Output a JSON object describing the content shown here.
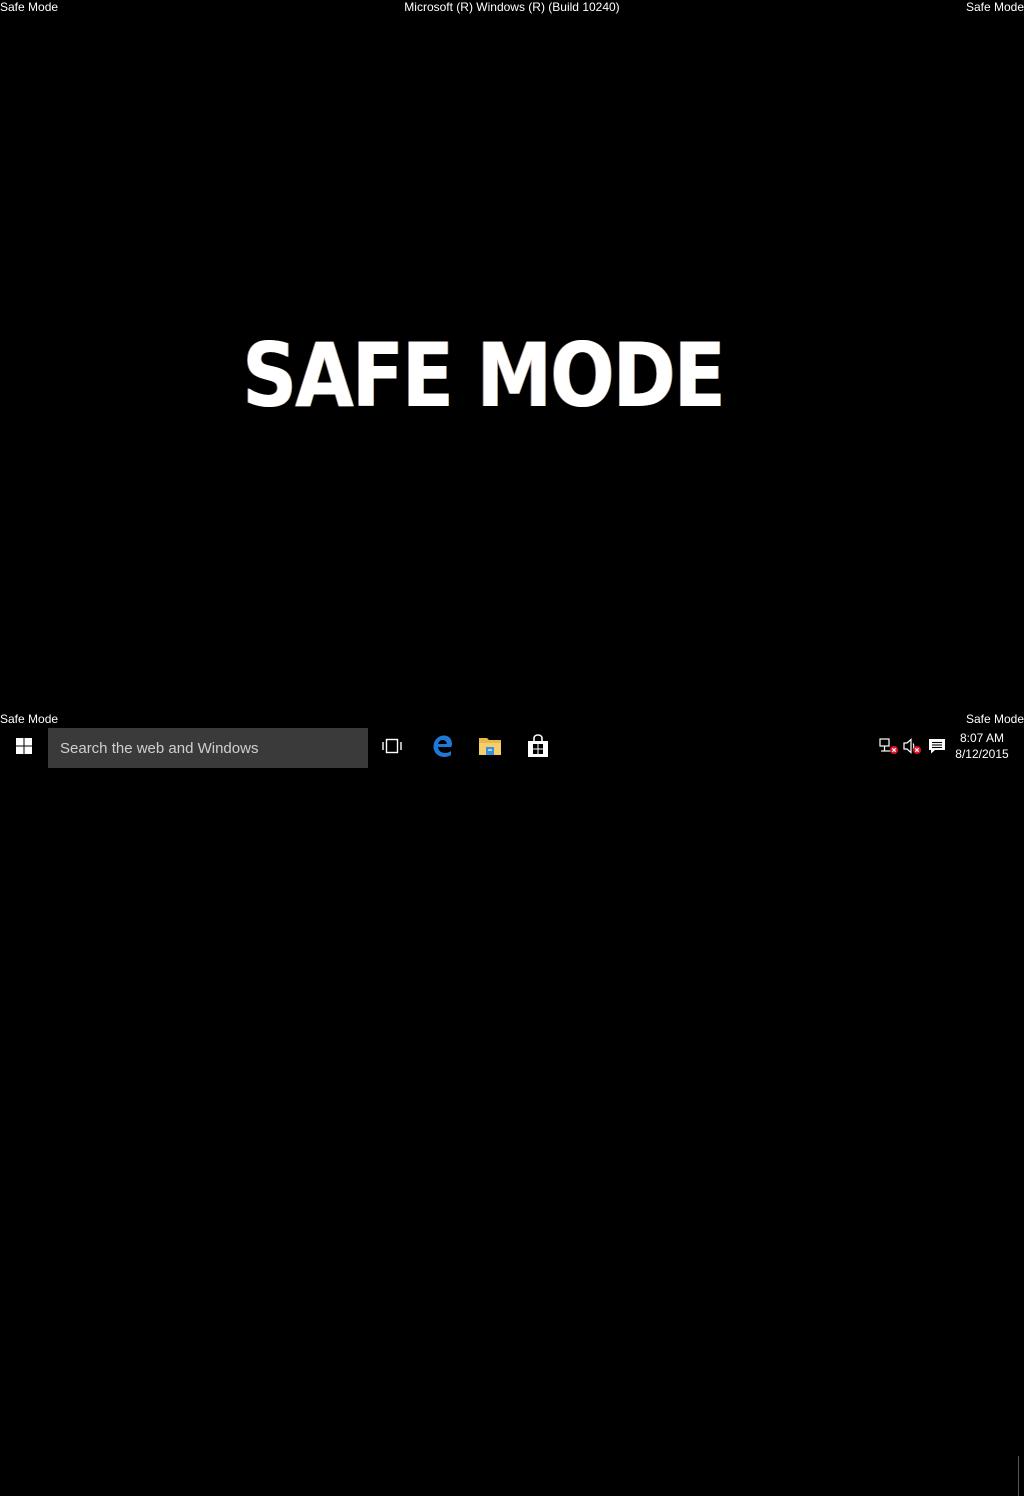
{
  "desktop": {
    "corner_top_left": "Safe Mode",
    "corner_top_right": "Safe Mode",
    "corner_bottom_left": "Safe Mode",
    "corner_bottom_right": "Safe Mode",
    "build_info": "Microsoft (R) Windows (R) (Build 10240)",
    "wallpaper_text": "SAFE MODE"
  },
  "taskbar": {
    "start_icon": "windows-logo-icon",
    "search": {
      "placeholder": "Search the web and Windows"
    },
    "pinned": [
      {
        "name": "task-view",
        "icon": "task-view-icon"
      },
      {
        "name": "edge",
        "icon": "edge-icon"
      },
      {
        "name": "file-explorer",
        "icon": "folder-icon"
      },
      {
        "name": "store",
        "icon": "store-icon"
      }
    ],
    "tray": {
      "network_icon": "network-disconnected-icon",
      "volume_icon": "volume-muted-icon",
      "action_center_icon": "action-center-icon",
      "time": "8:07 AM",
      "date": "8/12/2015"
    }
  },
  "colors": {
    "background": "#000000",
    "taskbar": "#000000",
    "search_box": "#3a3a3a",
    "edge_blue": "#1e78d7",
    "folder_yellow": "#e8b84a",
    "error_red": "#e81123"
  }
}
